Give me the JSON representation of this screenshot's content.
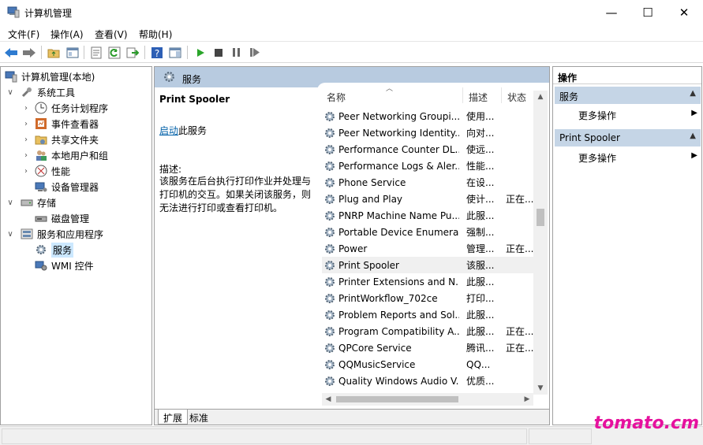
{
  "window": {
    "title": "计算机管理",
    "minimize": "—",
    "maximize": "☐",
    "close": "✕"
  },
  "menu": [
    "文件(F)",
    "操作(A)",
    "查看(V)",
    "帮助(H)"
  ],
  "tree": {
    "root": "计算机管理(本地)",
    "system_tools": "系统工具",
    "task_scheduler": "任务计划程序",
    "event_viewer": "事件查看器",
    "shared_folders": "共享文件夹",
    "local_users": "本地用户和组",
    "performance": "性能",
    "device_manager": "设备管理器",
    "storage": "存储",
    "disk_management": "磁盘管理",
    "services_apps": "服务和应用程序",
    "services": "服务",
    "wmi": "WMI 控件"
  },
  "middle": {
    "header": "服务",
    "detail": {
      "name": "Print Spooler",
      "start_link": "启动",
      "start_suffix": "此服务",
      "desc_label": "描述:",
      "description": "该服务在后台执行打印作业并处理与打印机的交互。如果关闭该服务，则无法进行打印或查看打印机。"
    },
    "columns": {
      "name": "名称",
      "desc": "描述",
      "status": "状态"
    },
    "services": [
      {
        "name": "Peer Networking Groupi...",
        "desc": "使用...",
        "status": ""
      },
      {
        "name": "Peer Networking Identity...",
        "desc": "向对...",
        "status": ""
      },
      {
        "name": "Performance Counter DL...",
        "desc": "使远...",
        "status": ""
      },
      {
        "name": "Performance Logs & Aler...",
        "desc": "性能...",
        "status": ""
      },
      {
        "name": "Phone Service",
        "desc": "在设...",
        "status": ""
      },
      {
        "name": "Plug and Play",
        "desc": "使计...",
        "status": "正在..."
      },
      {
        "name": "PNRP Machine Name Pu...",
        "desc": "此服...",
        "status": ""
      },
      {
        "name": "Portable Device Enumera...",
        "desc": "强制...",
        "status": ""
      },
      {
        "name": "Power",
        "desc": "管理...",
        "status": "正在..."
      },
      {
        "name": "Print Spooler",
        "desc": "该服...",
        "status": ""
      },
      {
        "name": "Printer Extensions and N...",
        "desc": "此服...",
        "status": ""
      },
      {
        "name": "PrintWorkflow_702ce",
        "desc": "打印...",
        "status": ""
      },
      {
        "name": "Problem Reports and Sol...",
        "desc": "此服...",
        "status": ""
      },
      {
        "name": "Program Compatibility A...",
        "desc": "此服...",
        "status": "正在..."
      },
      {
        "name": "QPCore Service",
        "desc": "腾讯...",
        "status": "正在..."
      },
      {
        "name": "QQMusicService",
        "desc": "QQ...",
        "status": ""
      },
      {
        "name": "Quality Windows Audio V...",
        "desc": "优质...",
        "status": ""
      }
    ],
    "tabs": [
      "扩展",
      "标准"
    ]
  },
  "actions": {
    "title": "操作",
    "section1": "服务",
    "section1_more": "更多操作",
    "section2": "Print Spooler",
    "section2_more": "更多操作"
  },
  "watermark": "tomato.cm"
}
